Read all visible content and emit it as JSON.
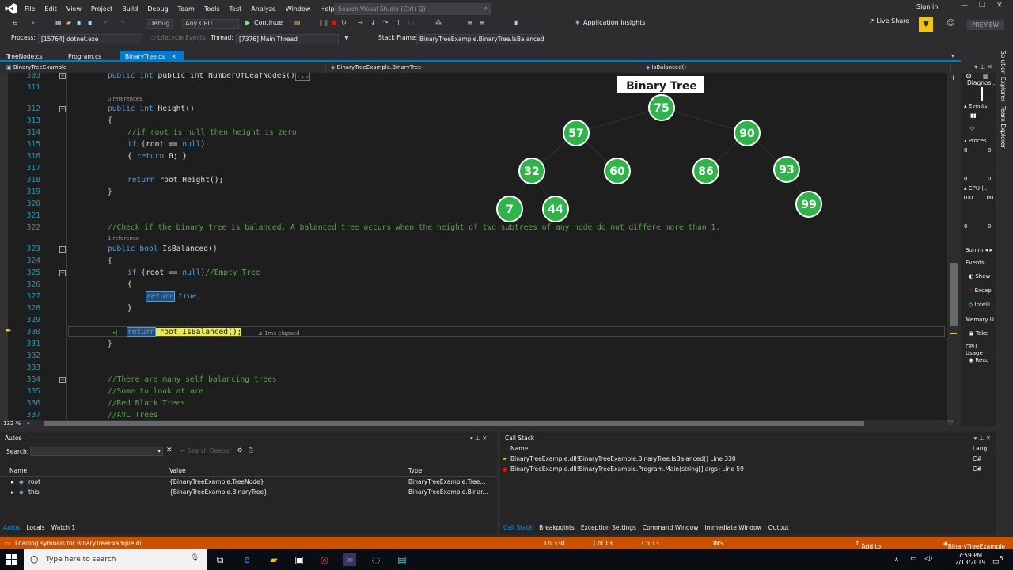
{
  "menu": {
    "items": [
      "File",
      "Edit",
      "View",
      "Project",
      "Build",
      "Debug",
      "Team",
      "Tools",
      "Test",
      "Analyze",
      "Window",
      "Help"
    ],
    "search_placeholder": "Search Visual Studio (Ctrl+Q)",
    "signin": "Sign in"
  },
  "toolbar": {
    "config": "Debug",
    "platform": "Any CPU",
    "continue": "Continue",
    "app_insights": "Application Insights",
    "live_share": "Live Share",
    "preview": "PREVIEW"
  },
  "procbar": {
    "process_label": "Process:",
    "process": "[15764] dotnet.exe",
    "lifecycle": "Lifecycle Events",
    "thread_label": "Thread:",
    "thread": "[7376] Main Thread",
    "stack_label": "Stack Frame:",
    "stack": "BinaryTreeExample.BinaryTree.IsBalanced"
  },
  "tabs": [
    "TreeNode.cs",
    "Program.cs",
    "BinaryTree.cs"
  ],
  "nav": {
    "project": "BinaryTreeExample",
    "class": "BinaryTreeExample.BinaryTree",
    "member": "IsBalanced()"
  },
  "code": {
    "l303": "303",
    "t303": "public int NumberOfLeafNodes()",
    "fold303": "...",
    "l311": "311",
    "ref312": "0 references",
    "l312": "312",
    "t312": "public int Height()",
    "l313": "313",
    "t313": "{",
    "l314": "314",
    "t314": "//if root is null then height is zero",
    "l315": "315",
    "t315a": "if",
    "t315b": " (root == ",
    "t315c": "null",
    ")": ")",
    "l316": "316",
    "t316a": "{ ",
    "t316b": "return",
    "t316c": " 0; }",
    "l317": "317",
    "l318": "318",
    "t318a": "return",
    "t318b": " root.Height();",
    "l319": "319",
    "t319": "}",
    "l320": "320",
    "l321": "321",
    "l322": "322",
    "t322": "//Check if the binary tree is balanced. A balanced tree occurs when the height of two subtrees of any node do not differe more than 1.",
    "ref323": "1 reference",
    "l323": "323",
    "t323a": "public bool",
    "t323b": " IsBalanced()",
    "l324": "324",
    "t324": "{",
    "l325": "325",
    "t325a": "if",
    "t325b": " (root == ",
    "t325c": "null",
    "t325d": ")",
    "t325e": "//Empty Tree",
    "l326": "326",
    "t326": "{",
    "l327": "327",
    "t327a": "return",
    "t327b": " true;",
    "l328": "328",
    "t328": "}",
    "l329": "329",
    "l330": "330",
    "t330a": "return",
    "t330b": " root.IsBalanced();",
    "elapsed": "≤ 1ms elapsed",
    "l331": "331",
    "t331": "}",
    "l332": "332",
    "l333": "333",
    "l334": "334",
    "t334": "//There are many self balancing trees",
    "l335": "335",
    "t335": "//Some to look at are",
    "l336": "336",
    "t336": "//Red Black Trees",
    "l337": "337",
    "t337": "//AVL Trees"
  },
  "tree": {
    "title": "Binary Tree",
    "nodes": [
      "75",
      "57",
      "90",
      "32",
      "60",
      "86",
      "93",
      "7",
      "44",
      "99"
    ],
    "color": "#2fb34a"
  },
  "zoom": "132 %",
  "diag": {
    "title": "Diagnos...",
    "events": "Events",
    "process": "Proces...",
    "cpu": "CPU (...",
    "v8a": "8",
    "v8b": "8",
    "v0a": "0",
    "v0b": "0",
    "v100a": "100",
    "v100b": "100",
    "v0c": "0",
    "v0d": "0",
    "summary": "Summ",
    "events2": "Events",
    "show": "Show",
    "excep": "Excep",
    "intelli": "Intelli",
    "memory": "Memory U",
    "take": "Take",
    "cpuusage": "CPU Usage",
    "record": "Reco"
  },
  "strip": {
    "solution": "Solution Explorer",
    "team": "Team Explorer"
  },
  "autos": {
    "title": "Autos",
    "search_label": "Search:",
    "search_deeper": "Search Deeper",
    "cols": [
      "Name",
      "Value",
      "Type"
    ],
    "rows": [
      {
        "name": "root",
        "value": "{BinaryTreeExample.TreeNode}",
        "type": "BinaryTreeExample.Tree..."
      },
      {
        "name": "this",
        "value": "{BinaryTreeExample.BinaryTree}",
        "type": "BinaryTreeExample.Binar..."
      }
    ],
    "tabs": [
      "Autos",
      "Locals",
      "Watch 1"
    ]
  },
  "callstack": {
    "title": "Call Stack",
    "cols": [
      "Name",
      "Lang"
    ],
    "rows": [
      {
        "name": "BinaryTreeExample.dll!BinaryTreeExample.BinaryTree.IsBalanced() Line 330",
        "lang": "C#"
      },
      {
        "name": "BinaryTreeExample.dll!BinaryTreeExample.Program.Main(string[] args) Line 59",
        "lang": "C#"
      }
    ],
    "tabs": [
      "Call Stack",
      "Breakpoints",
      "Exception Settings",
      "Command Window",
      "Immediate Window",
      "Output"
    ]
  },
  "status": {
    "msg": "Loading symbols for BinaryTreeExample.dll",
    "ln": "Ln 330",
    "col": "Col 13",
    "ch": "Ch 13",
    "ins": "INS",
    "add": "Add to Source Control",
    "proj": "BinaryTreeExample"
  },
  "taskbar": {
    "search": "Type here to search",
    "time": "7:59 PM",
    "date": "2/13/2019",
    "notif": "6"
  }
}
